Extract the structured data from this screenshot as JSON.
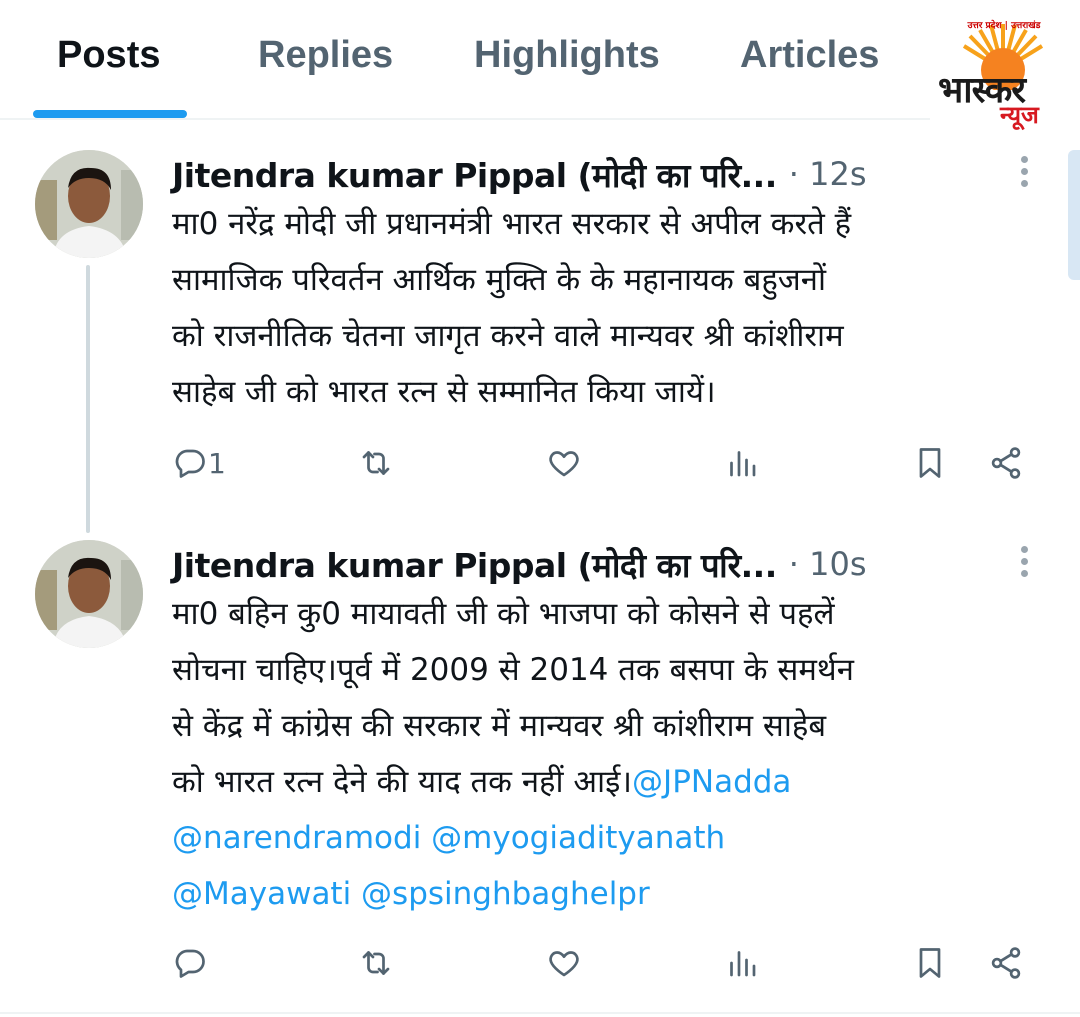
{
  "tabs": [
    {
      "label": "Posts",
      "active": true
    },
    {
      "label": "Replies",
      "active": false
    },
    {
      "label": "Highlights",
      "active": false
    },
    {
      "label": "Articles",
      "active": false
    }
  ],
  "logo": {
    "top_text": "उत्तर प्रदेश | उत्तराखंड",
    "word1": "भास्कर",
    "word2": "न्यूज"
  },
  "posts": [
    {
      "name": "Jitendra kumar Pippal (मोदी का परि...",
      "time": "· 12s",
      "text": "मा0 नरेंद्र मोदी जी प्रधानमंत्री भारत सरकार से अपील करते हैं\nसामाजिक परिवर्तन आर्थिक मुक्ति के के महानायक बहुजनों\nको राजनीतिक चेतना जागृत करने वाले मान्यवर श्री कांशीराम\nसाहेब जी को भारत रत्न से सम्मानित किया जायें।",
      "mentions_line1": "",
      "mentions_line2": "",
      "mentions_line3": "",
      "reply_count": "1"
    },
    {
      "name": "Jitendra kumar Pippal (मोदी का परि...",
      "time": "· 10s",
      "text": "मा0 बहिन कु0 मायावती जी को भाजपा को कोसने से पहलें\nसोचना चाहिए।पूर्व में 2009 से 2014 तक बसपा के समर्थन\nसे केंद्र में कांग्रेस की सरकार में मान्यवर श्री कांशीराम साहेब\nको भारत रत्न देने की याद तक नहीं आई।",
      "mentions_line1": "@JPNadda",
      "mentions_line2": "@narendramodi @myogiadityanath",
      "mentions_line3": "@Mayawati @spsinghbaghelpr",
      "reply_count": ""
    }
  ],
  "icons": [
    "reply-icon",
    "repost-icon",
    "like-icon",
    "views-icon",
    "bookmark-icon",
    "share-icon",
    "more-icon"
  ],
  "colors": {
    "accent": "#1d9bf0",
    "secondary_text": "#536471",
    "logo_red": "#d71920"
  }
}
